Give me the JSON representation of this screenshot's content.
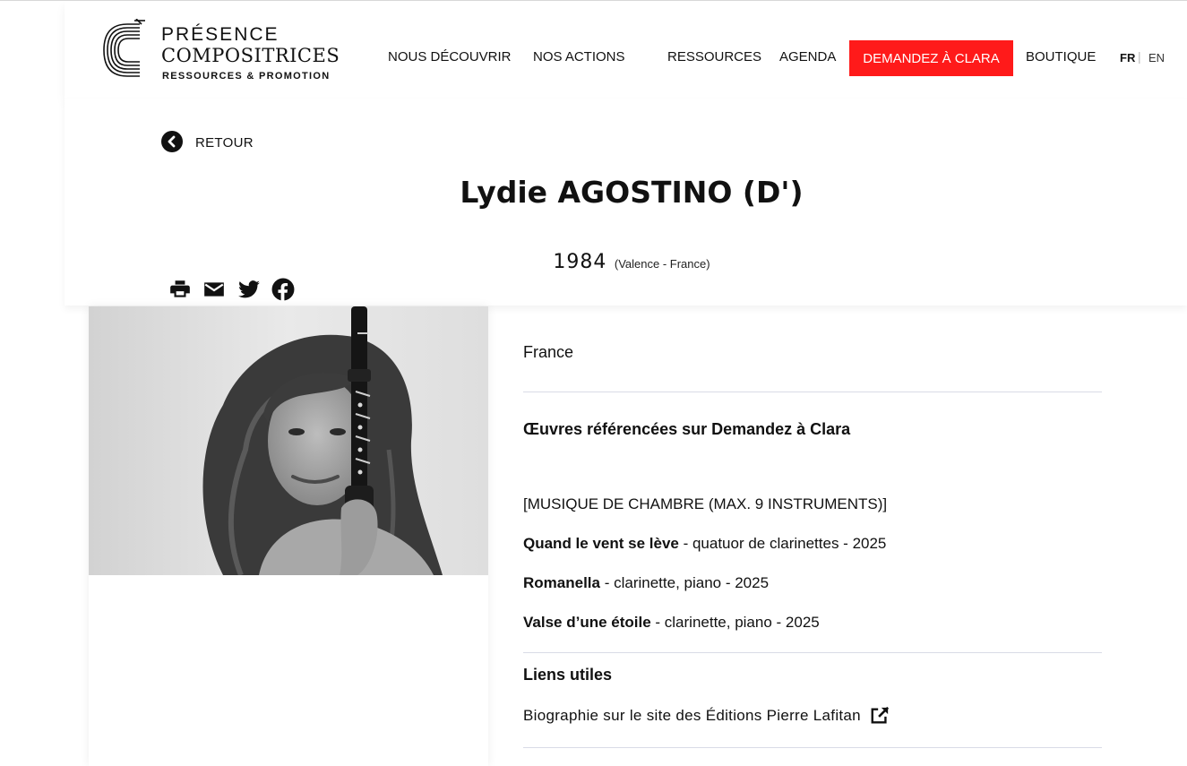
{
  "brand": {
    "line1": "PRÉSENCE",
    "line2": "COMPOSITRICES",
    "line3": "RESSOURCES & PROMOTION"
  },
  "nav": {
    "items": [
      "NOUS DÉCOUVRIR",
      "NOS ACTIONS",
      "RESSOURCES",
      "AGENDA",
      "BOUTIQUE"
    ],
    "cta": "DEMANDEZ À CLARA",
    "cta_color": "#ff1a1a",
    "lang_fr": "FR",
    "lang_sep": "|",
    "lang_en": "EN"
  },
  "back": {
    "label": "RETOUR",
    "icon": "chevron-left-circle-icon"
  },
  "composer": {
    "name": "Lydie AGOSTINO (D')",
    "birth_year": "1984",
    "birth_place": "(Valence - France)",
    "country": "France",
    "photo_alt": "Photo de Lydie Agostino tenant une clarinette"
  },
  "share_icons": [
    "print-icon",
    "email-icon",
    "twitter-icon",
    "facebook-icon"
  ],
  "works_section": {
    "title": "Œuvres référencées sur Demandez à Clara",
    "category": "[MUSIQUE DE CHAMBRE (MAX. 9 INSTRUMENTS)]",
    "works": [
      {
        "title": "Quand le vent se lève",
        "details": " - quatuor de clarinettes - 2025"
      },
      {
        "title": "Romanella",
        "details": " - clarinette, piano - 2025"
      },
      {
        "title": "Valse d’une étoile",
        "details": " - clarinette, piano - 2025"
      }
    ]
  },
  "links_section": {
    "title": "Liens utiles",
    "links": [
      "Biographie sur le site des Éditions Pierre Lafitan"
    ],
    "link_icon": "external-link-icon"
  }
}
